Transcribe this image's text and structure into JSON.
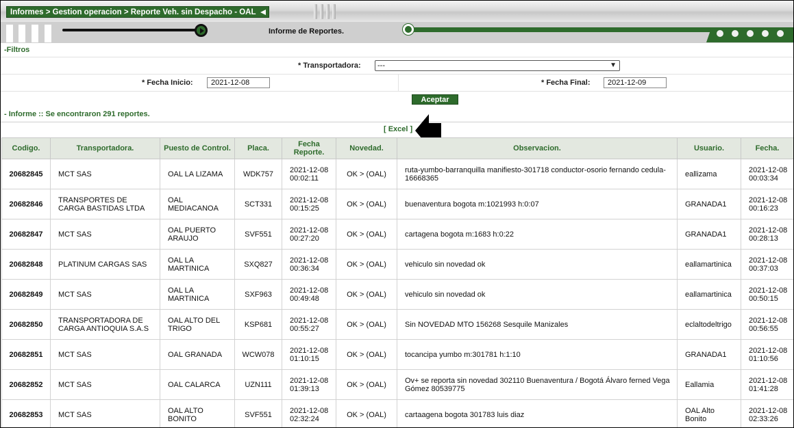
{
  "header": {
    "breadcrumb": "Informes > Gestion operacion > Reporte Veh. sin Despacho - OAL",
    "subtitle": "Informe de Reportes."
  },
  "filters": {
    "section_label": "-Filtros",
    "transportadora_label": "* Transportadora:",
    "transportadora_value": "---",
    "fecha_inicio_label": "* Fecha Inicio:",
    "fecha_inicio_value": "2021-12-08",
    "fecha_final_label": "* Fecha Final:",
    "fecha_final_value": "2021-12-09",
    "accept_label": "Aceptar"
  },
  "report": {
    "summary": "- Informe :: Se encontraron 291 reportes.",
    "excel_label": "[ Excel ]"
  },
  "table": {
    "headers": [
      "Codigo.",
      "Transportadora.",
      "Puesto de Control.",
      "Placa.",
      "Fecha Reporte.",
      "Novedad.",
      "Observacion.",
      "Usuario.",
      "Fecha."
    ],
    "rows": [
      {
        "codigo": "20682845",
        "transportadora": "MCT SAS",
        "puesto": "OAL LA LIZAMA",
        "placa": "WDK757",
        "fecha_reporte": "2021-12-08 00:02:11",
        "novedad": "OK > (OAL)",
        "observacion": "ruta-yumbo-barranquilla manifiesto-301718 conductor-osorio fernando cedula-16668365",
        "usuario": "eallizama",
        "fecha": "2021-12-08 00:03:34"
      },
      {
        "codigo": "20682846",
        "transportadora": "TRANSPORTES DE CARGA BASTIDAS LTDA",
        "puesto": "OAL MEDIACANOA",
        "placa": "SCT331",
        "fecha_reporte": "2021-12-08 00:15:25",
        "novedad": "OK > (OAL)",
        "observacion": "buenaventura bogota m:1021993 h:0:07",
        "usuario": "GRANADA1",
        "fecha": "2021-12-08 00:16:23"
      },
      {
        "codigo": "20682847",
        "transportadora": "MCT SAS",
        "puesto": "OAL PUERTO ARAUJO",
        "placa": "SVF551",
        "fecha_reporte": "2021-12-08 00:27:20",
        "novedad": "OK > (OAL)",
        "observacion": "cartagena bogota m:1683 h:0:22",
        "usuario": "GRANADA1",
        "fecha": "2021-12-08 00:28:13"
      },
      {
        "codigo": "20682848",
        "transportadora": "PLATINUM CARGAS SAS",
        "puesto": "OAL LA MARTINICA",
        "placa": "SXQ827",
        "fecha_reporte": "2021-12-08 00:36:34",
        "novedad": "OK > (OAL)",
        "observacion": "vehiculo sin novedad ok",
        "usuario": "eallamartinica",
        "fecha": "2021-12-08 00:37:03"
      },
      {
        "codigo": "20682849",
        "transportadora": "MCT SAS",
        "puesto": "OAL LA MARTINICA",
        "placa": "SXF963",
        "fecha_reporte": "2021-12-08 00:49:48",
        "novedad": "OK > (OAL)",
        "observacion": "vehiculo sin novedad ok",
        "usuario": "eallamartinica",
        "fecha": "2021-12-08 00:50:15"
      },
      {
        "codigo": "20682850",
        "transportadora": "TRANSPORTADORA DE CARGA ANTIOQUIA S.A.S",
        "puesto": "OAL ALTO DEL TRIGO",
        "placa": "KSP681",
        "fecha_reporte": "2021-12-08 00:55:27",
        "novedad": "OK > (OAL)",
        "observacion": "Sin NOVEDAD MTO 156268 Sesquile Manizales",
        "usuario": "eclaltodeltrigo",
        "fecha": "2021-12-08 00:56:55"
      },
      {
        "codigo": "20682851",
        "transportadora": "MCT SAS",
        "puesto": "OAL GRANADA",
        "placa": "WCW078",
        "fecha_reporte": "2021-12-08 01:10:15",
        "novedad": "OK > (OAL)",
        "observacion": "tocancipa yumbo m:301781 h:1:10",
        "usuario": "GRANADA1",
        "fecha": "2021-12-08 01:10:56"
      },
      {
        "codigo": "20682852",
        "transportadora": "MCT SAS",
        "puesto": "OAL CALARCA",
        "placa": "UZN111",
        "fecha_reporte": "2021-12-08 01:39:13",
        "novedad": "OK > (OAL)",
        "observacion": "Ov+ se reporta sin novedad 302110 Buenaventura / Bogotá Álvaro ferned Vega Gómez 80539775",
        "usuario": "Eallamia",
        "fecha": "2021-12-08 01:41:28"
      },
      {
        "codigo": "20682853",
        "transportadora": "MCT SAS",
        "puesto": "OAL ALTO BONITO",
        "placa": "SVF551",
        "fecha_reporte": "2021-12-08 02:32:24",
        "novedad": "OK > (OAL)",
        "observacion": "cartaagena bogota 301783 luis diaz",
        "usuario": "OAL Alto Bonito",
        "fecha": "2021-12-08 02:33:26"
      }
    ]
  },
  "colors": {
    "brand_green": "#2e6b2c",
    "header_gray": "#cfcfcf"
  }
}
